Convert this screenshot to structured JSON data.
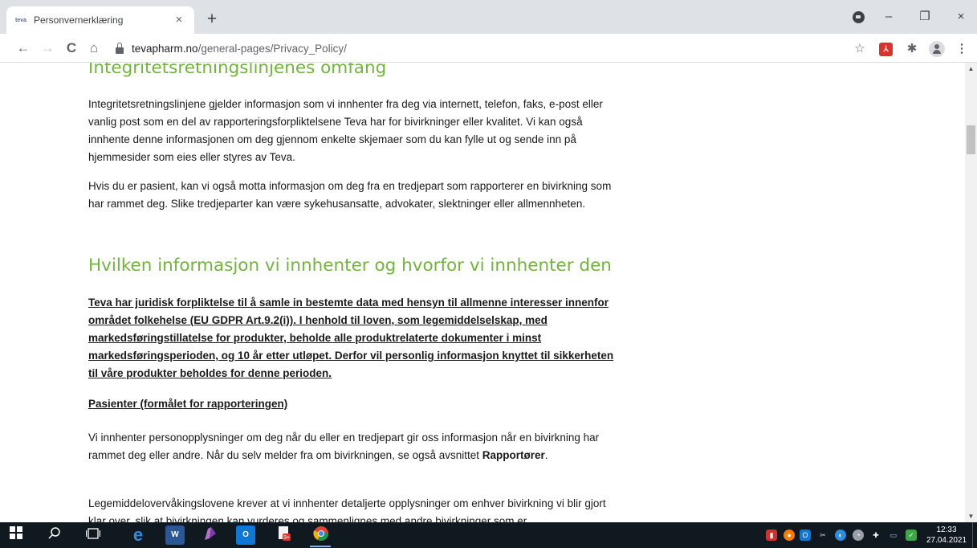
{
  "browser": {
    "tab": {
      "title": "Personvernerklæring",
      "favicon": "teva"
    },
    "new_tab_label": "+",
    "tab_close": "×",
    "window_controls": {
      "minimize": "–",
      "restore": "❐",
      "close": "×"
    },
    "nav": {
      "back": "←",
      "forward": "→",
      "reload": "C",
      "home": "⌂"
    },
    "url": {
      "domain": "tevapharm.no",
      "path": "/general-pages/Privacy_Policy/"
    },
    "toolbar_icons": {
      "bookmark": "☆",
      "pdf": "⅄",
      "extensions": "✱",
      "menu": "⋮"
    }
  },
  "page": {
    "heading_scope": "Integritetsretningslinjenes omfang",
    "para_scope_1": "Integritetsretningslinjene gjelder informasjon som vi innhenter fra deg via internett, telefon, faks, e-post eller vanlig post som en del av rapporteringsforpliktelsene Teva har for bivirkninger eller kvalitet. Vi kan også innhente denne informasjonen om deg gjennom enkelte skjemaer som du kan fylle ut og sende inn på hjemmesider som eies eller styres av Teva.",
    "para_scope_2": "Hvis du er pasient, kan vi også motta informasjon om deg fra en tredjepart som rapporterer en bivirkning som har rammet deg. Slike tredjeparter kan være sykehusansatte, advokater, slektninger eller allmennheten.",
    "heading_what": "Hvilken informasjon vi innhenter og hvorfor vi innhenter den",
    "para_legal": "Teva har juridisk forpliktelse til å samle in bestemte data med hensyn til allmenne interesser innenfor området folkehelse (EU GDPR Art.9.2(i)). I henhold til loven, som legemiddelselskap, med markedsføringstillatelse for produkter, beholde alle produktrelaterte dokumenter i minst markedsføringsperioden, og 10 år etter utløpet. Derfor vil personlig informasjon knyttet til sikkerheten til våre produkter beholdes for denne perioden.",
    "subheading_patients": "Pasienter (formålet for rapporteringen)",
    "para_patients_text": "Vi innhenter personopplysninger om deg når du eller en tredjepart gir oss informasjon når en bivirkning har rammet deg eller andre. Når du selv melder fra om bivirkningen, se også avsnittet ",
    "para_patients_strong": "Rapportører",
    "para_patients_end": ".",
    "para_pharmaco": "Legemiddelovervåkingslovene krever at vi innhenter detaljerte opplysninger om enhver bivirkning vi blir gjort klar over, slik at bivirkningen kan vurderes og sammenlignes med andre bivirkninger som er"
  },
  "taskbar": {
    "clock_time": "12:33",
    "clock_date": "27.04.2021"
  },
  "colors": {
    "heading_green": "#70b53c",
    "chrome_tabstrip": "#dee1e6",
    "taskbar": "#101820"
  }
}
